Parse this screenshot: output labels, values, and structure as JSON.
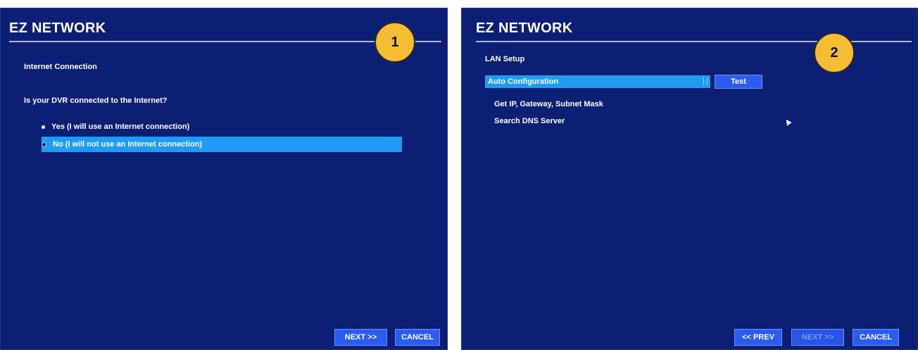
{
  "screen1": {
    "title": "EZ NETWORK",
    "badge": "1",
    "section_label": "Internet Connection",
    "question": "Is your DVR connected to the Internet?",
    "options": [
      {
        "label": "Yes (I will use an Internet connection)",
        "selected": false
      },
      {
        "label": "No (I will not use an Internet connection)",
        "selected": true
      }
    ],
    "next_label": "NEXT >>",
    "cancel_label": "CANCEL"
  },
  "screen2": {
    "title": "EZ NETWORK",
    "badge": "2",
    "section_label": "LAN Setup",
    "config_select_value": "Auto Configuration",
    "test_label": "Test",
    "info_lines": [
      "Get IP, Gateway, Subnet Mask",
      "Search DNS Server"
    ],
    "prev_label": "<< PREV",
    "next_label": "NEXT >>",
    "cancel_label": "CANCEL"
  },
  "colors": {
    "screen_bg": "#0d1f74",
    "highlight": "#1f9cf2",
    "button": "#2a5cf0",
    "badge": "#f5bd34"
  }
}
